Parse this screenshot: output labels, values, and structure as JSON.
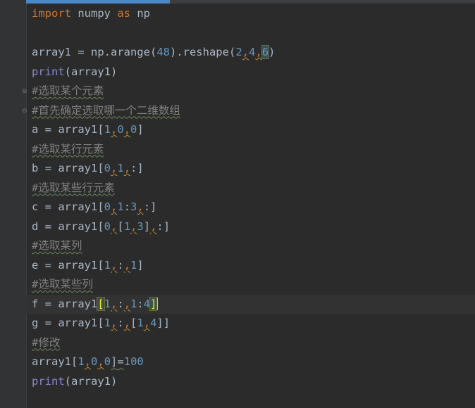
{
  "editor": {
    "progress_fraction": 0.32,
    "lines": [
      [
        {
          "t": "import",
          "c": "kw"
        },
        {
          "t": " numpy "
        },
        {
          "t": "as",
          "c": "kw"
        },
        {
          "t": " np"
        }
      ],
      [],
      [
        {
          "t": "array1 = np.arange("
        },
        {
          "t": "48",
          "c": "num"
        },
        {
          "t": ").reshape("
        },
        {
          "t": "2",
          "c": "num"
        },
        {
          "t": ",",
          "c": "comma"
        },
        {
          "t": "4",
          "c": "num"
        },
        {
          "t": ",",
          "c": "comma"
        },
        {
          "t": "6",
          "c": "num hl-num"
        },
        {
          "t": ")"
        }
      ],
      [
        {
          "t": "print",
          "c": "fn"
        },
        {
          "t": "(array1)"
        }
      ],
      [
        {
          "t": "#选取某个元素",
          "c": "comment squiggle"
        }
      ],
      [
        {
          "t": "#首先确定选取哪一个二维数组",
          "c": "comment squiggle"
        }
      ],
      [
        {
          "t": "a = array1["
        },
        {
          "t": "1",
          "c": "num"
        },
        {
          "t": ",",
          "c": "comma"
        },
        {
          "t": "0",
          "c": "num"
        },
        {
          "t": ",",
          "c": "comma"
        },
        {
          "t": "0",
          "c": "num"
        },
        {
          "t": "]"
        }
      ],
      [
        {
          "t": "#选取某行元素",
          "c": "comment squiggle"
        }
      ],
      [
        {
          "t": "b = array1["
        },
        {
          "t": "0",
          "c": "num"
        },
        {
          "t": ",",
          "c": "comma"
        },
        {
          "t": "1",
          "c": "num"
        },
        {
          "t": ",",
          "c": "comma"
        },
        {
          "t": ":]"
        }
      ],
      [
        {
          "t": "#选取某些行元素",
          "c": "comment squiggle"
        }
      ],
      [
        {
          "t": "c = array1["
        },
        {
          "t": "0",
          "c": "num"
        },
        {
          "t": ",",
          "c": "comma"
        },
        {
          "t": "1",
          "c": "num"
        },
        {
          "t": ":"
        },
        {
          "t": "3",
          "c": "num"
        },
        {
          "t": ",",
          "c": "comma"
        },
        {
          "t": ":]"
        }
      ],
      [
        {
          "t": "d = array1["
        },
        {
          "t": "0",
          "c": "num"
        },
        {
          "t": ",",
          "c": "comma"
        },
        {
          "t": "["
        },
        {
          "t": "1",
          "c": "num"
        },
        {
          "t": ",",
          "c": "comma"
        },
        {
          "t": "3",
          "c": "num"
        },
        {
          "t": "]"
        },
        {
          "t": ",",
          "c": "comma"
        },
        {
          "t": ":]"
        }
      ],
      [
        {
          "t": "#选取某列",
          "c": "comment squiggle"
        }
      ],
      [
        {
          "t": "e = array1["
        },
        {
          "t": "1",
          "c": "num"
        },
        {
          "t": ",",
          "c": "comma"
        },
        {
          "t": ":"
        },
        {
          "t": ",",
          "c": "comma"
        },
        {
          "t": "1",
          "c": "num"
        },
        {
          "t": "]"
        }
      ],
      [
        {
          "t": "#选取某些列",
          "c": "comment squiggle"
        }
      ],
      [
        {
          "t": "f = array1"
        },
        {
          "t": "[",
          "c": "bracket-match"
        },
        {
          "t": "1",
          "c": "num"
        },
        {
          "t": ",",
          "c": "comma"
        },
        {
          "t": ":"
        },
        {
          "t": ",",
          "c": "comma"
        },
        {
          "t": "1",
          "c": "num"
        },
        {
          "t": ":"
        },
        {
          "t": "4",
          "c": "num"
        },
        {
          "t": "]",
          "c": "bracket-match"
        }
      ],
      [
        {
          "t": "g = array1["
        },
        {
          "t": "1",
          "c": "num"
        },
        {
          "t": ",",
          "c": "comma"
        },
        {
          "t": ":"
        },
        {
          "t": ",",
          "c": "comma"
        },
        {
          "t": "["
        },
        {
          "t": "1",
          "c": "num"
        },
        {
          "t": ",",
          "c": "comma"
        },
        {
          "t": "4",
          "c": "num"
        },
        {
          "t": "]]"
        }
      ],
      [
        {
          "t": "#修改",
          "c": "comment squiggle"
        }
      ],
      [
        {
          "t": "array1["
        },
        {
          "t": "1",
          "c": "num"
        },
        {
          "t": ",",
          "c": "comma"
        },
        {
          "t": "0",
          "c": "num"
        },
        {
          "t": ",",
          "c": "comma"
        },
        {
          "t": "0",
          "c": "num"
        },
        {
          "t": "]",
          "c": "squiggle"
        },
        {
          "t": "=",
          "c": "squiggle"
        },
        {
          "t": "100",
          "c": "num"
        }
      ],
      [
        {
          "t": "print",
          "c": "fn"
        },
        {
          "t": "(array1)"
        }
      ]
    ],
    "current_line": 15,
    "fold_markers": [
      {
        "line": 4,
        "icon": "fold-open-icon",
        "glyph": "⊖"
      },
      {
        "line": 5,
        "icon": "fold-close-icon",
        "glyph": "⊖"
      }
    ]
  }
}
